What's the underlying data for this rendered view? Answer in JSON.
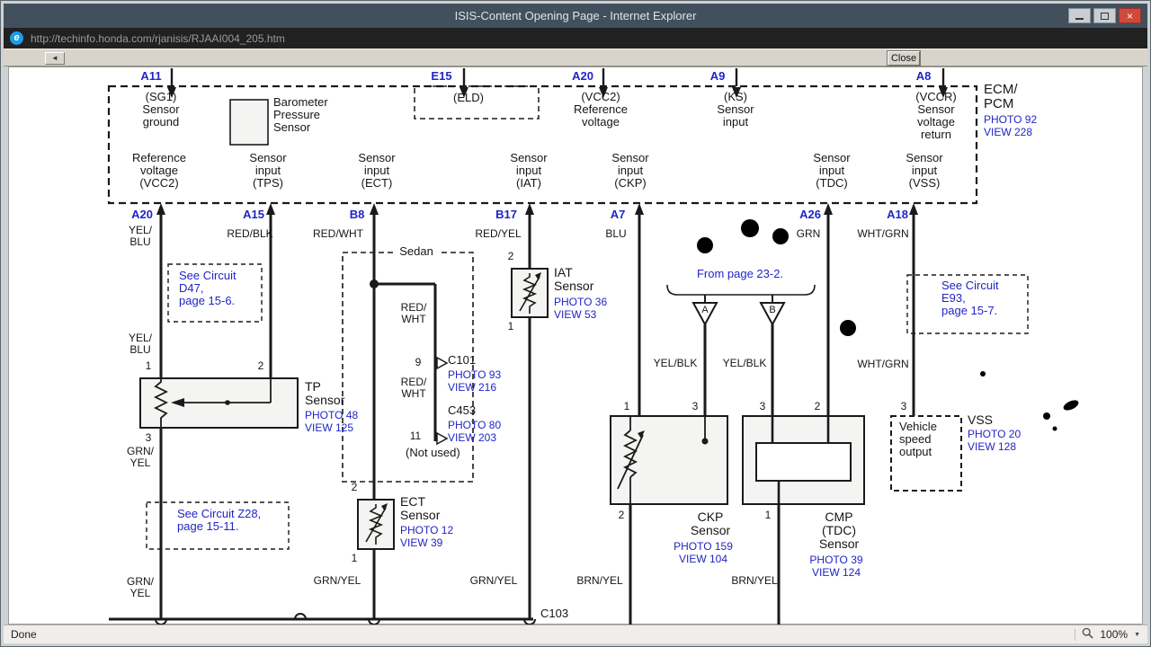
{
  "window": {
    "title": "ISIS-Content Opening Page - Internet Explorer",
    "address": "http://techinfo.honda.com/rjanisis/RJAAI004_205.htm",
    "close_button": "Close",
    "status": "Done",
    "zoom": "100%",
    "icons": {
      "ie": "e",
      "back": "◄",
      "caret": "▼",
      "close_glyph": "×"
    }
  },
  "ecm": {
    "label": "ECM/\nPCM",
    "photo_link": "PHOTO 92",
    "view_link": "VIEW 228",
    "baro_label": "Barometer\nPressure\nSensor",
    "pins_top": {
      "a11": {
        "id": "A11",
        "signal": "(SG1)\nSensor\nground"
      },
      "e15": {
        "id": "E15",
        "signal": "(ELD)"
      },
      "a20": {
        "id": "A20",
        "signal": "(VCC2)\nReference\nvoltage"
      },
      "a9": {
        "id": "A9",
        "signal": "(KS)\nSensor\ninput"
      },
      "a8": {
        "id": "A8",
        "signal": "(VCCR)\nSensor\nvoltage\nreturn"
      }
    },
    "pins_bottom": {
      "a20": {
        "id": "A20",
        "signal": "Reference\nvoltage\n(VCC2)",
        "wire": "YEL/\nBLU"
      },
      "a15": {
        "id": "A15",
        "signal": "Sensor\ninput\n(TPS)",
        "wire": "RED/BLK"
      },
      "b8": {
        "id": "B8",
        "signal": "Sensor\ninput\n(ECT)",
        "wire": "RED/WHT"
      },
      "b17": {
        "id": "B17",
        "signal": "Sensor\ninput\n(IAT)",
        "wire": "RED/YEL"
      },
      "a7": {
        "id": "A7",
        "signal": "Sensor\ninput\n(CKP)",
        "wire": "BLU"
      },
      "a26": {
        "id": "A26",
        "signal": "Sensor\ninput\n(TDC)",
        "wire": "GRN"
      },
      "a18": {
        "id": "A18",
        "signal": "Sensor\ninput\n(VSS)",
        "wire": "WHT/GRN"
      }
    }
  },
  "tp": {
    "name": "TP\nSensor",
    "photo": "PHOTO 48",
    "view": "VIEW 125",
    "pin1": "1",
    "pin2": "2",
    "pin3": "3",
    "wire_top": "YEL/\nBLU",
    "wire_mid": "GRN/\nYEL",
    "wire_bottom": "GRN/\nYEL"
  },
  "ect": {
    "name": "ECT\nSensor",
    "photo": "PHOTO 12",
    "view": "VIEW 39",
    "pin2": "2",
    "pin1": "1",
    "wire_bottom": "GRN/YEL"
  },
  "iat": {
    "name": "IAT\nSensor",
    "photo": "PHOTO 36",
    "view": "VIEW 53",
    "pin2": "2",
    "pin1": "1",
    "wire_bottom": "GRN/YEL"
  },
  "ckp": {
    "name": "CKP\nSensor",
    "photo": "PHOTO 159",
    "view": "VIEW 104",
    "pin1": "1",
    "pin3": "3",
    "pin2": "2",
    "wire_in": "YEL/BLK",
    "wire_bottom": "BRN/YEL"
  },
  "cmp": {
    "name": "CMP\n(TDC)\nSensor",
    "photo": "PHOTO 39",
    "view": "VIEW 124",
    "pin3": "3",
    "pin2": "2",
    "pin1": "1",
    "wire_in": "YEL/BLK",
    "wire_bottom": "BRN/YEL"
  },
  "vss": {
    "name": "VSS",
    "photo": "PHOTO 20",
    "view": "VIEW 128",
    "box_label": "Vehicle\nspeed\noutput",
    "pin3": "3",
    "wire_top": "WHT/GRN"
  },
  "sedan": {
    "label": "Sedan",
    "wire1": "RED/\nWHT",
    "wire2": "RED/\nWHT",
    "pin9": "9",
    "pin11": "11",
    "not_used": "(Not used)",
    "c101": {
      "name": "C101",
      "photo": "PHOTO 93",
      "view": "VIEW 216"
    },
    "c453": {
      "name": "C453",
      "photo": "PHOTO 80",
      "view": "VIEW 203"
    }
  },
  "refs": {
    "d47": "See Circuit\nD47,\npage 15-6.",
    "z28": "See Circuit Z28,\npage 15-11.",
    "e93": "See Circuit\nE93,\npage 15-7.",
    "from_page": "From page 23-2.",
    "tri_a": "A",
    "tri_b": "B",
    "c103": "C103"
  }
}
